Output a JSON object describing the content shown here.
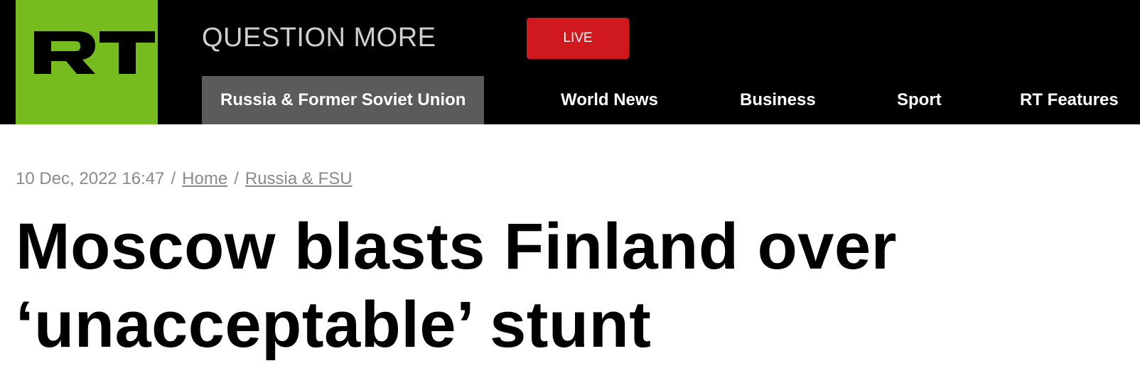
{
  "header": {
    "logo_text": "RT",
    "tagline": "QUESTION MORE",
    "live_label": "LIVE"
  },
  "nav": {
    "items": [
      {
        "label": "Russia & Former Soviet Union",
        "active": true
      },
      {
        "label": "World News",
        "active": false
      },
      {
        "label": "Business",
        "active": false
      },
      {
        "label": "Sport",
        "active": false
      },
      {
        "label": "RT Features",
        "active": false
      }
    ]
  },
  "article": {
    "timestamp": "10 Dec, 2022 16:47",
    "separator": "/",
    "breadcrumb": [
      "Home",
      "Russia & FSU"
    ],
    "headline_line1": "Moscow blasts Finland over",
    "headline_line2": "‘unacceptable’ stunt"
  },
  "colors": {
    "brand_green": "#77bc1f",
    "live_red": "#d0191f",
    "header_bg": "#000000",
    "active_nav_bg": "#5b5b5b",
    "meta_gray": "#8a8a8a"
  }
}
